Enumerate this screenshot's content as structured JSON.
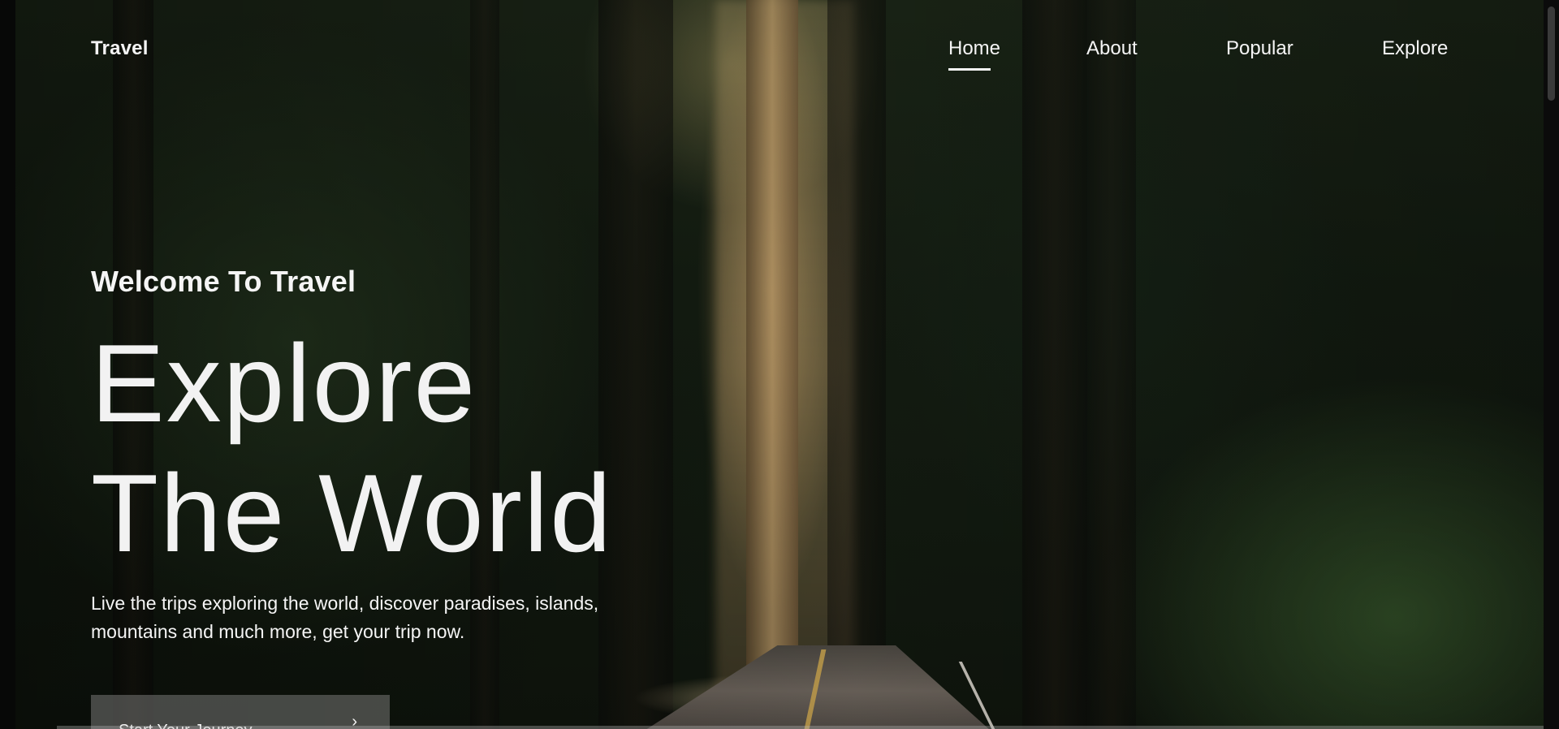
{
  "header": {
    "brand": "Travel",
    "nav": [
      {
        "label": "Home",
        "active": true
      },
      {
        "label": "About",
        "active": false
      },
      {
        "label": "Popular",
        "active": false
      },
      {
        "label": "Explore",
        "active": false
      }
    ]
  },
  "hero": {
    "welcome": "Welcome To Travel",
    "title_line1": "Explore",
    "title_line2": "The World",
    "description": "Live the trips exploring the world, discover paradises, islands, mountains and much more, get your trip now.",
    "cta_label": "Start Your Journey",
    "cta_icon": "arrow-right-icon"
  },
  "colors": {
    "text": "#f5f5f5",
    "cta_background": "rgba(120,120,118,0.55)",
    "scrollbar_thumb": "#3a3a3a"
  }
}
